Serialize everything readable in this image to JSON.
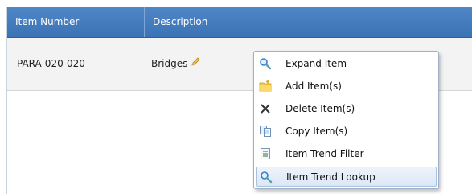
{
  "table": {
    "columns": [
      "Item Number",
      "Description"
    ],
    "rows": [
      {
        "item_number": "PARA-020-020",
        "description": "Bridges"
      }
    ]
  },
  "context_menu": {
    "items": [
      {
        "label": "Expand Item",
        "icon": "magnifier-icon"
      },
      {
        "label": "Add Item(s)",
        "icon": "folder-add-icon"
      },
      {
        "label": "Delete Item(s)",
        "icon": "x-delete-icon"
      },
      {
        "label": "Copy Item(s)",
        "icon": "copy-icon"
      },
      {
        "label": "Item Trend Filter",
        "icon": "filter-doc-icon"
      },
      {
        "label": "Item Trend Lookup",
        "icon": "magnifier-icon"
      }
    ],
    "highlighted_item": "Item Trend Lookup"
  },
  "colors": {
    "header": "#4e86c6",
    "row": "#f3f3f3",
    "menu_border": "#9fb1c8",
    "menu_highlight": "#dce7f6"
  }
}
